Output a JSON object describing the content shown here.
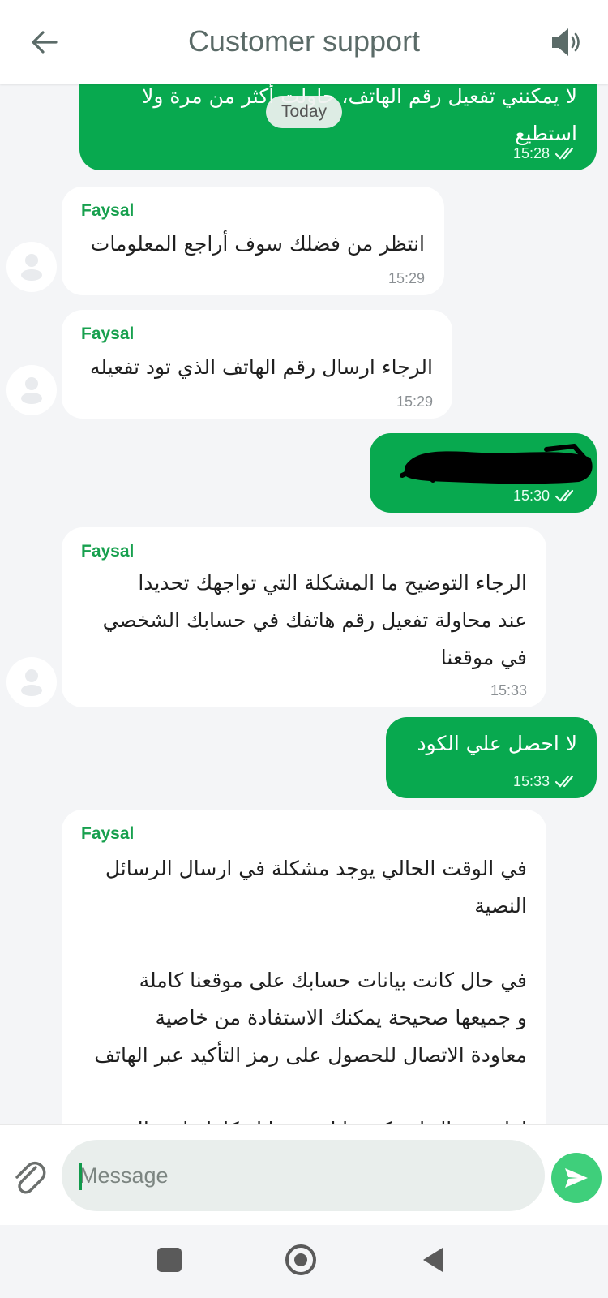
{
  "header": {
    "title": "Customer support"
  },
  "chat": {
    "date_pill": "Today",
    "messages": [
      {
        "dir": "out",
        "text": "لا يمكنني تفعيل رقم الهاتف، حاولت أكثر من مرة ولا\nاستطيع",
        "time": "15:28",
        "status": "read"
      },
      {
        "dir": "in",
        "sender": "Faysal",
        "text": "انتظر من فضلك سوف أراجع المعلومات",
        "time": "15:29"
      },
      {
        "dir": "in",
        "sender": "Faysal",
        "text": "الرجاء ارسال رقم الهاتف الذي تود تفعيله",
        "time": "15:29"
      },
      {
        "dir": "out",
        "text": "",
        "redacted": true,
        "time": "15:30",
        "status": "read"
      },
      {
        "dir": "in",
        "sender": "Faysal",
        "text": "الرجاء التوضيح ما المشكلة التي تواجهك تحديدا\nعند محاولة تفعيل رقم هاتفك في حسابك الشخصي\nفي موقعنا",
        "time": "15:33"
      },
      {
        "dir": "out",
        "text": "لا احصل علي الكود",
        "time": "15:33",
        "status": "read"
      },
      {
        "dir": "in",
        "sender": "Faysal",
        "text": "في الوقت الحالي يوجد مشكلة في ارسال الرسائل\nالنصية\n\nفي حال كانت بيانات حسابك على موقعنا كاملة\nو جميعها صحيحة يمكنك الاستفادة من خاصية\nمعاودة الاتصال للحصول على رمز التأكيد عبر الهاتف\n\nاما في حال لم تكن بيانات حسابك كاملة او هناك\nبيانات خاطئة",
        "time": ""
      }
    ]
  },
  "composer": {
    "placeholder": "Message"
  },
  "icons": {
    "back": "arrow-left-icon",
    "sound": "speaker-icon",
    "attach": "paperclip-icon",
    "send": "send-icon"
  },
  "colors": {
    "outgoing": "#08a94f",
    "sender_name": "#17a04e",
    "send_button": "#3fcf7b",
    "title": "#5b6b68"
  }
}
